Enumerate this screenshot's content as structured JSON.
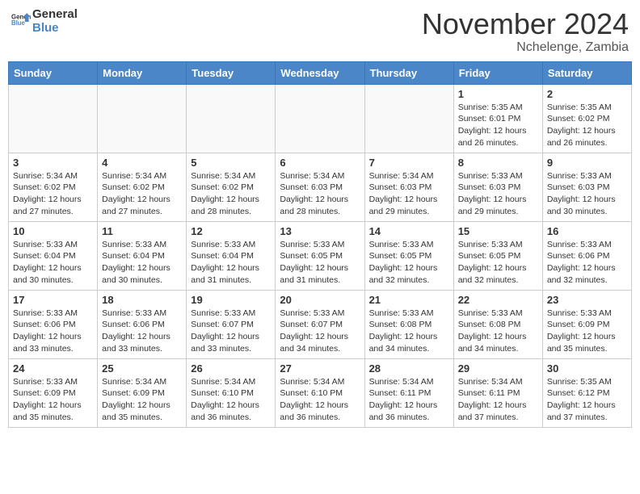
{
  "header": {
    "logo_line1": "General",
    "logo_line2": "Blue",
    "month_year": "November 2024",
    "location": "Nchelenge, Zambia"
  },
  "weekdays": [
    "Sunday",
    "Monday",
    "Tuesday",
    "Wednesday",
    "Thursday",
    "Friday",
    "Saturday"
  ],
  "weeks": [
    [
      {
        "day": "",
        "info": ""
      },
      {
        "day": "",
        "info": ""
      },
      {
        "day": "",
        "info": ""
      },
      {
        "day": "",
        "info": ""
      },
      {
        "day": "",
        "info": ""
      },
      {
        "day": "1",
        "info": "Sunrise: 5:35 AM\nSunset: 6:01 PM\nDaylight: 12 hours and 26 minutes."
      },
      {
        "day": "2",
        "info": "Sunrise: 5:35 AM\nSunset: 6:02 PM\nDaylight: 12 hours and 26 minutes."
      }
    ],
    [
      {
        "day": "3",
        "info": "Sunrise: 5:34 AM\nSunset: 6:02 PM\nDaylight: 12 hours and 27 minutes."
      },
      {
        "day": "4",
        "info": "Sunrise: 5:34 AM\nSunset: 6:02 PM\nDaylight: 12 hours and 27 minutes."
      },
      {
        "day": "5",
        "info": "Sunrise: 5:34 AM\nSunset: 6:02 PM\nDaylight: 12 hours and 28 minutes."
      },
      {
        "day": "6",
        "info": "Sunrise: 5:34 AM\nSunset: 6:03 PM\nDaylight: 12 hours and 28 minutes."
      },
      {
        "day": "7",
        "info": "Sunrise: 5:34 AM\nSunset: 6:03 PM\nDaylight: 12 hours and 29 minutes."
      },
      {
        "day": "8",
        "info": "Sunrise: 5:33 AM\nSunset: 6:03 PM\nDaylight: 12 hours and 29 minutes."
      },
      {
        "day": "9",
        "info": "Sunrise: 5:33 AM\nSunset: 6:03 PM\nDaylight: 12 hours and 30 minutes."
      }
    ],
    [
      {
        "day": "10",
        "info": "Sunrise: 5:33 AM\nSunset: 6:04 PM\nDaylight: 12 hours and 30 minutes."
      },
      {
        "day": "11",
        "info": "Sunrise: 5:33 AM\nSunset: 6:04 PM\nDaylight: 12 hours and 30 minutes."
      },
      {
        "day": "12",
        "info": "Sunrise: 5:33 AM\nSunset: 6:04 PM\nDaylight: 12 hours and 31 minutes."
      },
      {
        "day": "13",
        "info": "Sunrise: 5:33 AM\nSunset: 6:05 PM\nDaylight: 12 hours and 31 minutes."
      },
      {
        "day": "14",
        "info": "Sunrise: 5:33 AM\nSunset: 6:05 PM\nDaylight: 12 hours and 32 minutes."
      },
      {
        "day": "15",
        "info": "Sunrise: 5:33 AM\nSunset: 6:05 PM\nDaylight: 12 hours and 32 minutes."
      },
      {
        "day": "16",
        "info": "Sunrise: 5:33 AM\nSunset: 6:06 PM\nDaylight: 12 hours and 32 minutes."
      }
    ],
    [
      {
        "day": "17",
        "info": "Sunrise: 5:33 AM\nSunset: 6:06 PM\nDaylight: 12 hours and 33 minutes."
      },
      {
        "day": "18",
        "info": "Sunrise: 5:33 AM\nSunset: 6:06 PM\nDaylight: 12 hours and 33 minutes."
      },
      {
        "day": "19",
        "info": "Sunrise: 5:33 AM\nSunset: 6:07 PM\nDaylight: 12 hours and 33 minutes."
      },
      {
        "day": "20",
        "info": "Sunrise: 5:33 AM\nSunset: 6:07 PM\nDaylight: 12 hours and 34 minutes."
      },
      {
        "day": "21",
        "info": "Sunrise: 5:33 AM\nSunset: 6:08 PM\nDaylight: 12 hours and 34 minutes."
      },
      {
        "day": "22",
        "info": "Sunrise: 5:33 AM\nSunset: 6:08 PM\nDaylight: 12 hours and 34 minutes."
      },
      {
        "day": "23",
        "info": "Sunrise: 5:33 AM\nSunset: 6:09 PM\nDaylight: 12 hours and 35 minutes."
      }
    ],
    [
      {
        "day": "24",
        "info": "Sunrise: 5:33 AM\nSunset: 6:09 PM\nDaylight: 12 hours and 35 minutes."
      },
      {
        "day": "25",
        "info": "Sunrise: 5:34 AM\nSunset: 6:09 PM\nDaylight: 12 hours and 35 minutes."
      },
      {
        "day": "26",
        "info": "Sunrise: 5:34 AM\nSunset: 6:10 PM\nDaylight: 12 hours and 36 minutes."
      },
      {
        "day": "27",
        "info": "Sunrise: 5:34 AM\nSunset: 6:10 PM\nDaylight: 12 hours and 36 minutes."
      },
      {
        "day": "28",
        "info": "Sunrise: 5:34 AM\nSunset: 6:11 PM\nDaylight: 12 hours and 36 minutes."
      },
      {
        "day": "29",
        "info": "Sunrise: 5:34 AM\nSunset: 6:11 PM\nDaylight: 12 hours and 37 minutes."
      },
      {
        "day": "30",
        "info": "Sunrise: 5:35 AM\nSunset: 6:12 PM\nDaylight: 12 hours and 37 minutes."
      }
    ]
  ]
}
